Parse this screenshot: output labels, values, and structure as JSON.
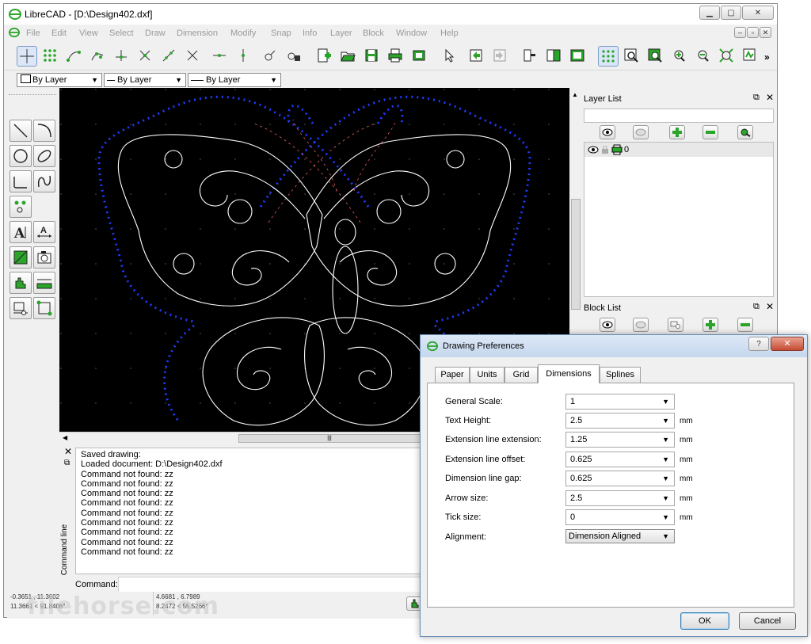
{
  "window": {
    "title": "LibreCAD - [D:\\Design402.dxf]",
    "controls": [
      "▁",
      "▢",
      "✕"
    ]
  },
  "menu": [
    "File",
    "Edit",
    "View",
    "Select",
    "Draw",
    "Dimension",
    "Modify",
    "Snap",
    "Info",
    "Layer",
    "Block",
    "Window",
    "Help"
  ],
  "toolbar_overflow": "»",
  "pen_combos": {
    "color": "By Layer",
    "linetype": "By Layer",
    "width": "By Layer"
  },
  "layer_list": {
    "title": "Layer List",
    "layers": [
      {
        "name": "0"
      }
    ]
  },
  "block_list": {
    "title": "Block List"
  },
  "command_dock": {
    "side_label": "Command line",
    "history": [
      "Saved drawing:",
      "Loaded document: D:\\Design402.dxf",
      "Command not found: zz",
      "Command not found: zz",
      "Command not found: zz",
      "Command not found: zz",
      "Command not found: zz",
      "Command not found: zz",
      "Command not found: zz",
      "Command not found: zz",
      "Command not found: zz"
    ],
    "prompt": "Command:"
  },
  "status": {
    "abs_cart": "-0.3651 , 11.3602",
    "abs_polar": "11.3661 < 91.8406°",
    "rel_cart": "4.6681 , 6.7989",
    "rel_polar": "8.2472 < 55.5266°"
  },
  "watermark": "filehorse.com",
  "dialog": {
    "title": "Drawing Preferences",
    "tabs": [
      "Paper",
      "Units",
      "Grid",
      "Dimensions",
      "Splines"
    ],
    "active_tab": "Dimensions",
    "fields": [
      {
        "label": "General Scale:",
        "value": "1",
        "unit": ""
      },
      {
        "label": "Text Height:",
        "value": "2.5",
        "unit": "mm"
      },
      {
        "label": "Extension line extension:",
        "value": "1.25",
        "unit": "mm"
      },
      {
        "label": "Extension line offset:",
        "value": "0.625",
        "unit": "mm"
      },
      {
        "label": "Dimension line gap:",
        "value": "0.625",
        "unit": "mm"
      },
      {
        "label": "Arrow size:",
        "value": "2.5",
        "unit": "mm"
      },
      {
        "label": "Tick size:",
        "value": "0",
        "unit": "mm"
      },
      {
        "label": "Alignment:",
        "value": "Dimension Aligned",
        "unit": ""
      }
    ],
    "ok_label": "OK",
    "cancel_label": "Cancel",
    "help_label": "?",
    "close_label": "✕"
  },
  "colors": {
    "canvas_bg": "#000000",
    "entity": "#ffffff",
    "dotted": "#1e3cff",
    "toolbar_green": "#2aa52a"
  }
}
